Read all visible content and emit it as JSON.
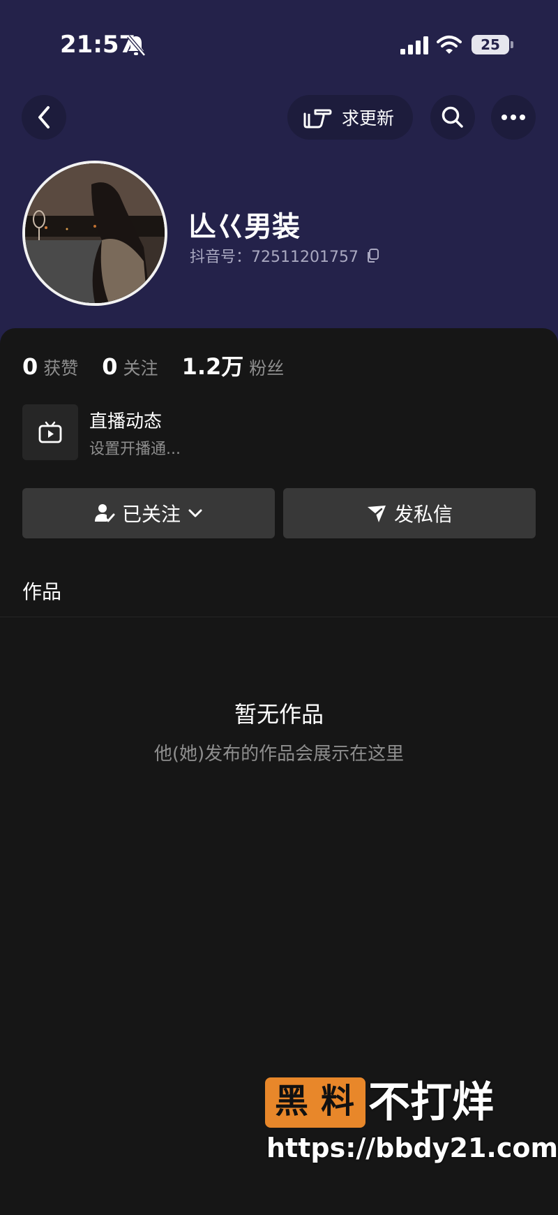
{
  "status_bar": {
    "time": "21:57",
    "battery": "25",
    "icons": [
      "bell-slash-icon",
      "signal-icon",
      "wifi-icon",
      "battery-icon"
    ]
  },
  "nav": {
    "back_icon": "chevron-left-icon",
    "request_update_label": "求更新",
    "request_update_icon": "pointing-hand-icon",
    "search_icon": "search-icon",
    "more_icon": "ellipsis-icon"
  },
  "profile": {
    "name": "亾巜男装",
    "douyin_id": "抖音号：72511201757",
    "copy_icon": "copy-icon"
  },
  "stats": [
    {
      "value": "0",
      "label": "获赞"
    },
    {
      "value": "0",
      "label": "关注"
    },
    {
      "value": "1.2万",
      "label": "粉丝"
    }
  ],
  "live": {
    "icon": "tv-play-icon",
    "title": "直播动态",
    "subtitle": "设置开播通..."
  },
  "actions": {
    "follow_label": "已关注",
    "follow_icon": "user-check-icon",
    "message_label": "发私信",
    "message_icon": "send-icon"
  },
  "tabs": {
    "works_label": "作品"
  },
  "empty_state": {
    "title": "暂无作品",
    "subtitle": "他(她)发布的作品会展示在这里"
  },
  "watermark": {
    "brand_1": "黑",
    "brand_2": "料",
    "brand_rest": "不打烊",
    "url": "https://bbdy21.com"
  },
  "colors": {
    "header_bg": "#24224a",
    "page_bg": "#161616",
    "button_bg": "#383838",
    "watermark_orange": "#e8872a"
  }
}
